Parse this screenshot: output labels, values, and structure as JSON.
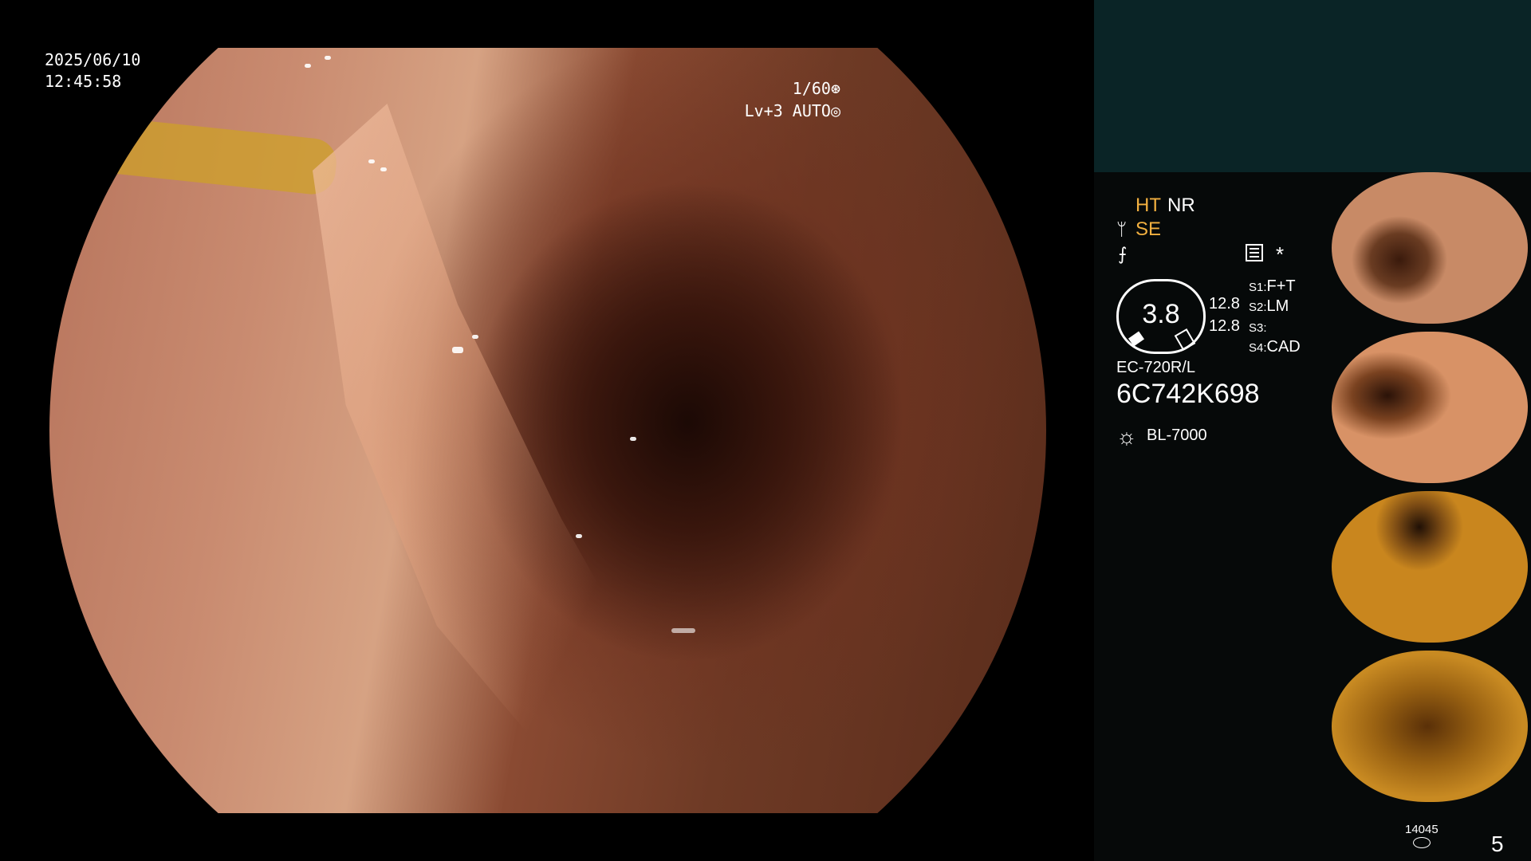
{
  "main_view": {
    "date": "2025/06/10",
    "time": "12:45:58",
    "shutter": "1/60⊛",
    "level": "Lv+3 AUTO◎"
  },
  "panel": {
    "ht": "HT",
    "nr": "NR",
    "se": "SE",
    "se_icon": "ᛘ",
    "filter_icon": "⨍",
    "star": "*",
    "gauge_value": "3.8",
    "num1": "12.8",
    "num2": "12.8",
    "s1_label": "S1:",
    "s1_value": "F+T",
    "s2_label": "S2:",
    "s2_value": "LM",
    "s3_label": "S3:",
    "s3_value": "",
    "s4_label": "S4:",
    "s4_value": "CAD",
    "scope_model": "EC-720R/L",
    "scope_serial": "6C742K698",
    "light_source": "BL-7000",
    "image_count": "14045",
    "page_number": "5"
  },
  "colors": {
    "panel_top": "#0a2426",
    "panel_bg": "#060909",
    "accent": "#f2b040"
  },
  "icons": {
    "light": "sun-icon",
    "storage": "disk-icon",
    "menu": "menu-icon"
  }
}
